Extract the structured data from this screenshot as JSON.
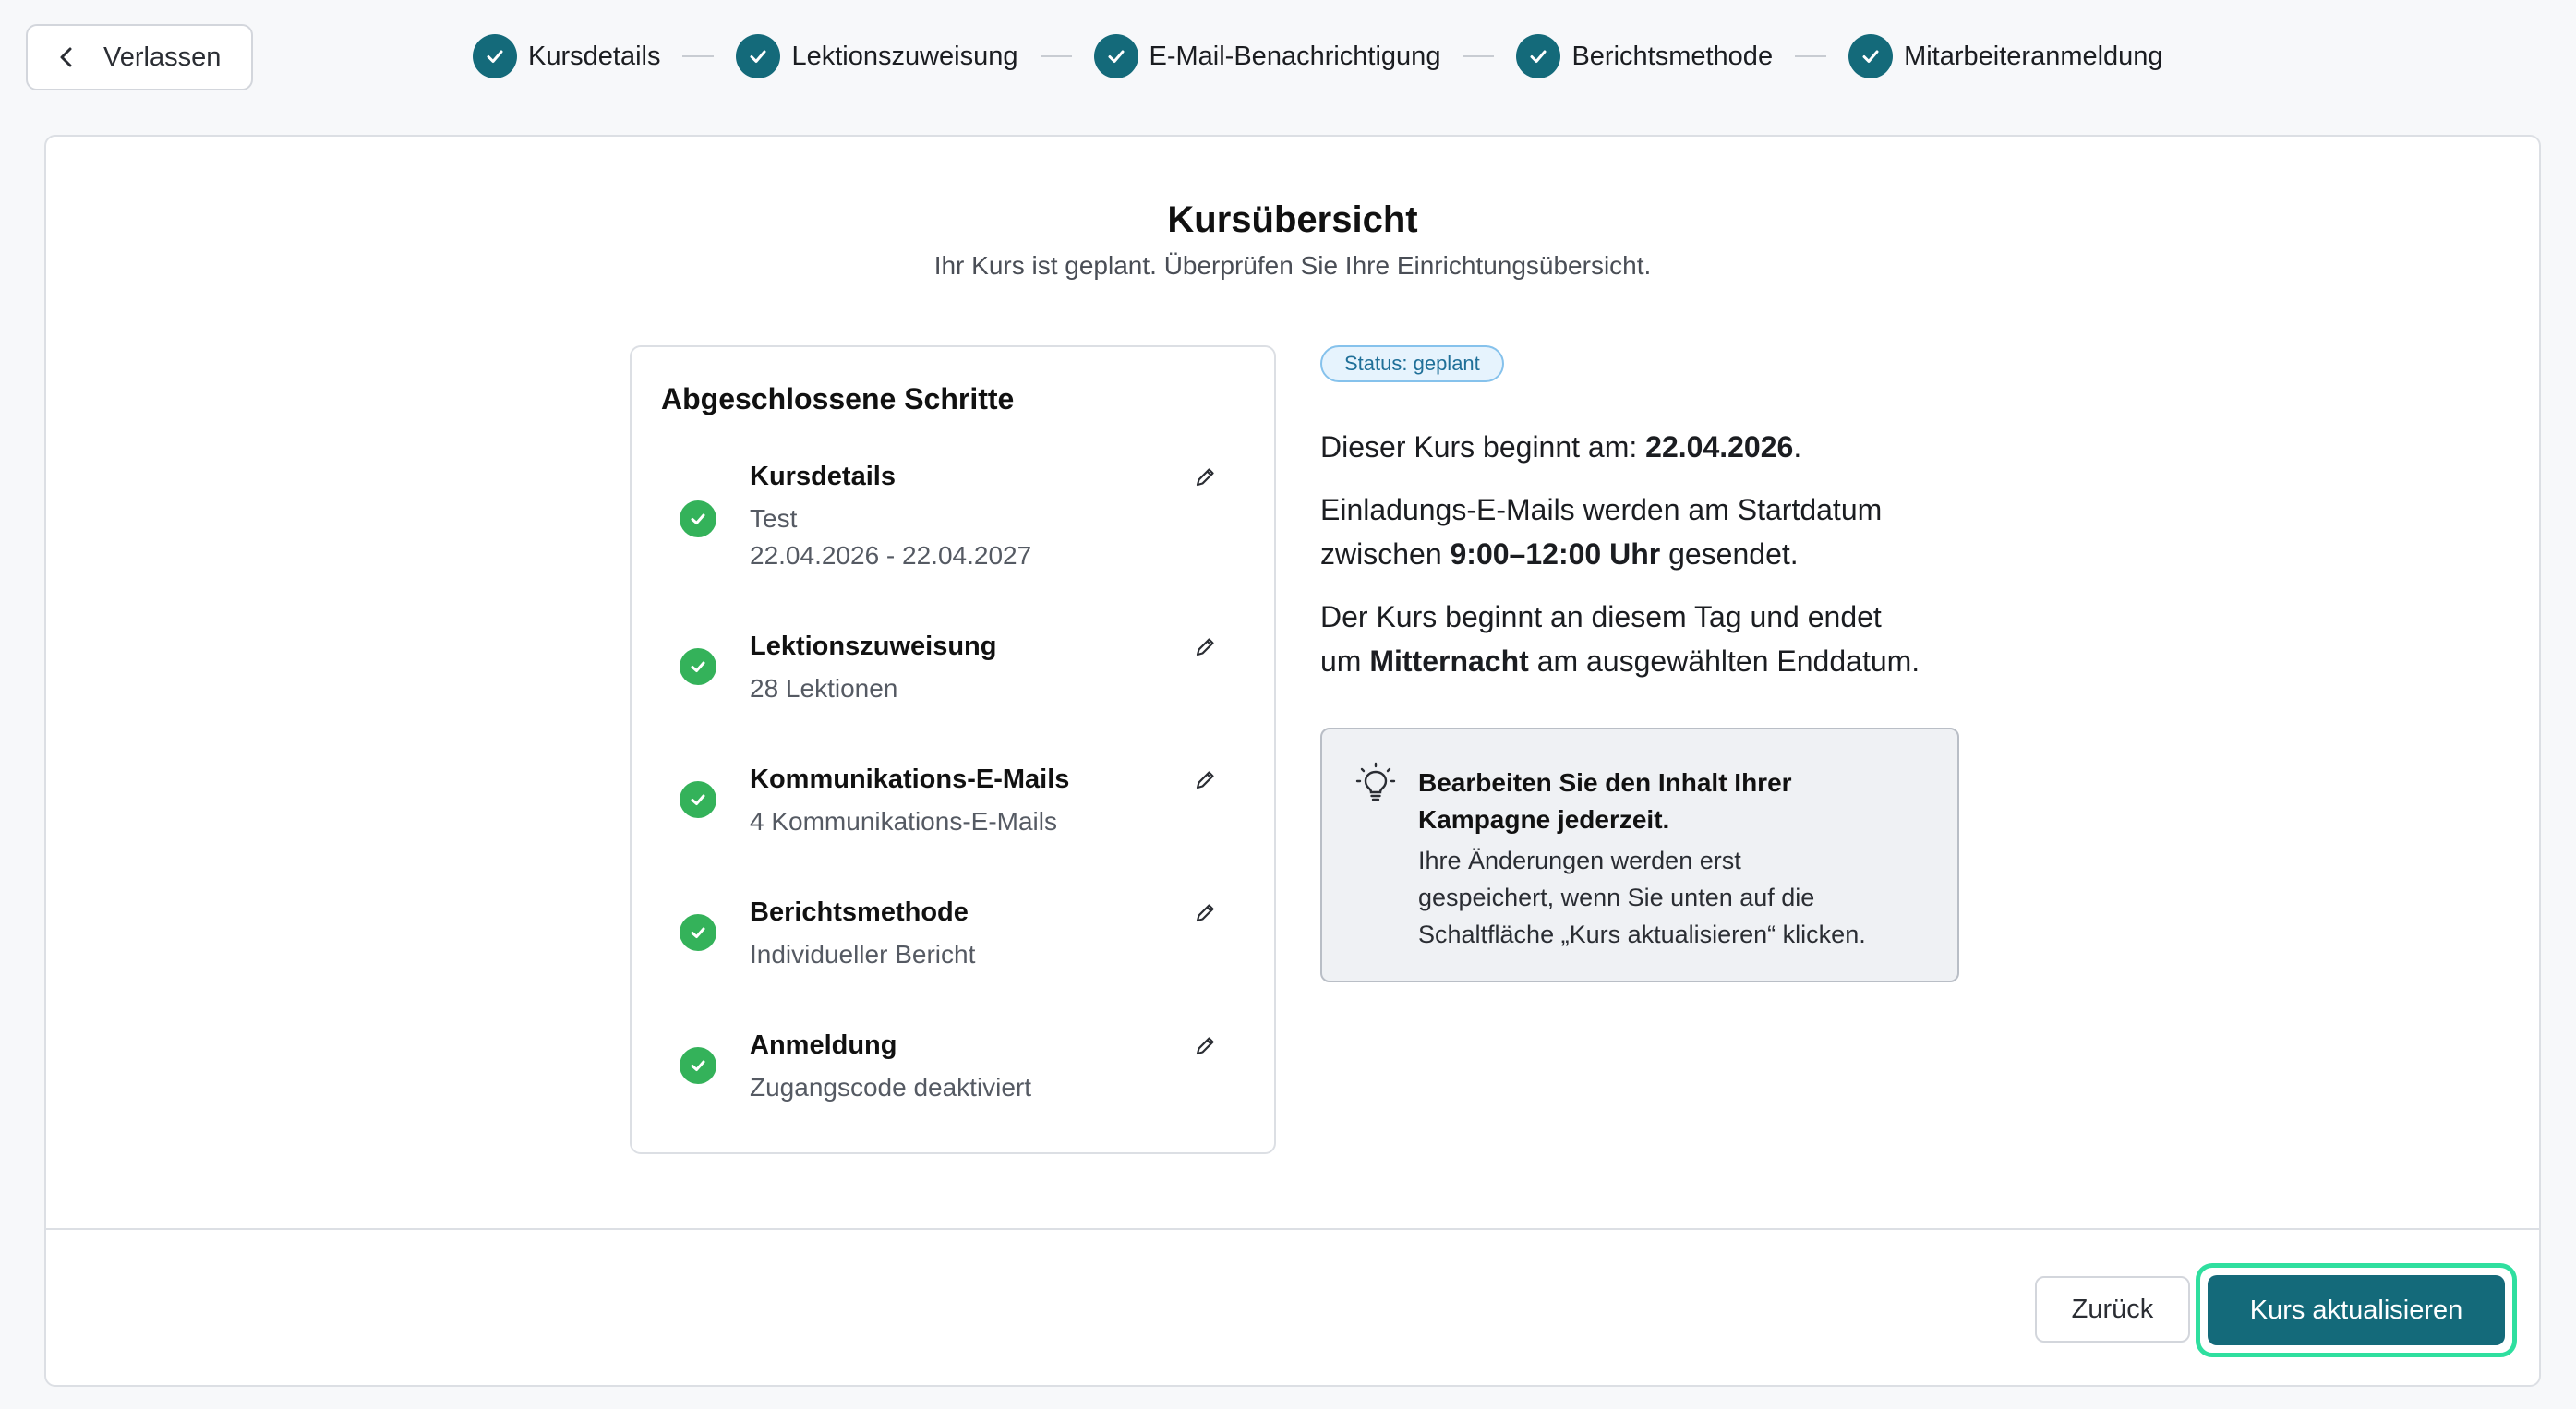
{
  "topbar": {
    "exit_label": "Verlassen",
    "steps": [
      {
        "label": "Kursdetails"
      },
      {
        "label": "Lektionszuweisung"
      },
      {
        "label": "E-Mail-Benachrichtigung"
      },
      {
        "label": "Berichtsmethode"
      },
      {
        "label": "Mitarbeiteranmeldung"
      }
    ]
  },
  "main": {
    "title": "Kursübersicht",
    "subtitle": "Ihr Kurs ist geplant. Überprüfen Sie Ihre Einrichtungsübersicht."
  },
  "completed": {
    "heading": "Abgeschlossene Schritte",
    "items": [
      {
        "name": "Kursdetails",
        "details": [
          "Test",
          "22.04.2026 - 22.04.2027"
        ]
      },
      {
        "name": "Lektionszuweisung",
        "details": [
          "28 Lektionen"
        ]
      },
      {
        "name": "Kommunikations-E-Mails",
        "details": [
          "4 Kommunikations-E-Mails"
        ]
      },
      {
        "name": "Berichtsmethode",
        "details": [
          "Individueller Bericht"
        ]
      },
      {
        "name": "Anmeldung",
        "details": [
          "Zugangscode deaktiviert"
        ]
      }
    ]
  },
  "summary": {
    "status_badge": "Status: geplant",
    "start_prefix": "Dieser Kurs beginnt am: ",
    "start_date": "22.04.2026",
    "start_suffix": ".",
    "invite_line1": "Einladungs-E-Mails werden am Startdatum",
    "invite_prefix": "zwischen ",
    "invite_time": "9:00–12:00 Uhr",
    "invite_suffix": " gesendet.",
    "end_line1": "Der Kurs beginnt an diesem Tag und endet",
    "end_prefix": "um ",
    "end_time": "Mitternacht",
    "end_suffix": " am ausgewählten Enddatum."
  },
  "tip": {
    "title_line1": "Bearbeiten Sie den Inhalt Ihrer",
    "title_line2": "Kampagne jederzeit.",
    "body_line1": "Ihre Änderungen werden erst",
    "body_line2": "gespeichert, wenn Sie unten auf die",
    "body_line3": "Schaltfläche „Kurs aktualisieren“ klicken."
  },
  "footer": {
    "back_label": "Zurück",
    "update_label": "Kurs aktualisieren"
  },
  "colors": {
    "primary": "#146a7a",
    "success": "#34b25a",
    "focus_ring": "#2fdf9f"
  }
}
